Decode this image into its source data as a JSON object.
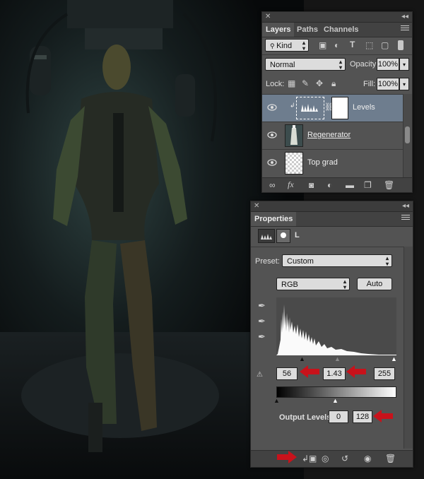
{
  "layers_panel": {
    "tabs": [
      "Layers",
      "Paths",
      "Channels"
    ],
    "filter_kind": "Kind",
    "blend_mode": "Normal",
    "opacity_label": "Opacity:",
    "opacity_value": "100%",
    "lock_label": "Lock:",
    "fill_label": "Fill:",
    "fill_value": "100%",
    "layers": [
      {
        "name": "Levels",
        "selected": true
      },
      {
        "name": "Regenerator",
        "selected": false
      },
      {
        "name": "Top grad",
        "selected": false
      }
    ],
    "footer_icons": [
      "link-icon",
      "fx-icon",
      "mask-icon",
      "adjustment-icon",
      "group-folder-icon",
      "new-layer-icon",
      "trash-icon"
    ]
  },
  "properties_panel": {
    "tab": "Properties",
    "header_label": "L",
    "preset_label": "Preset:",
    "preset_value": "Custom",
    "channel_value": "RGB",
    "auto_button": "Auto",
    "input_black": "56",
    "input_gamma": "1.43",
    "input_white": "255",
    "output_label": "Output Levels:",
    "output_black": "0",
    "output_white": "128",
    "footer_icons": [
      "clip-to-layer-icon",
      "view-previous-icon",
      "reset-icon",
      "visibility-eye-icon",
      "trash-icon"
    ]
  },
  "colors": {
    "panel_bg": "#535353",
    "selected_row": "#6e7d8e",
    "annotation_red": "#c8121b"
  }
}
